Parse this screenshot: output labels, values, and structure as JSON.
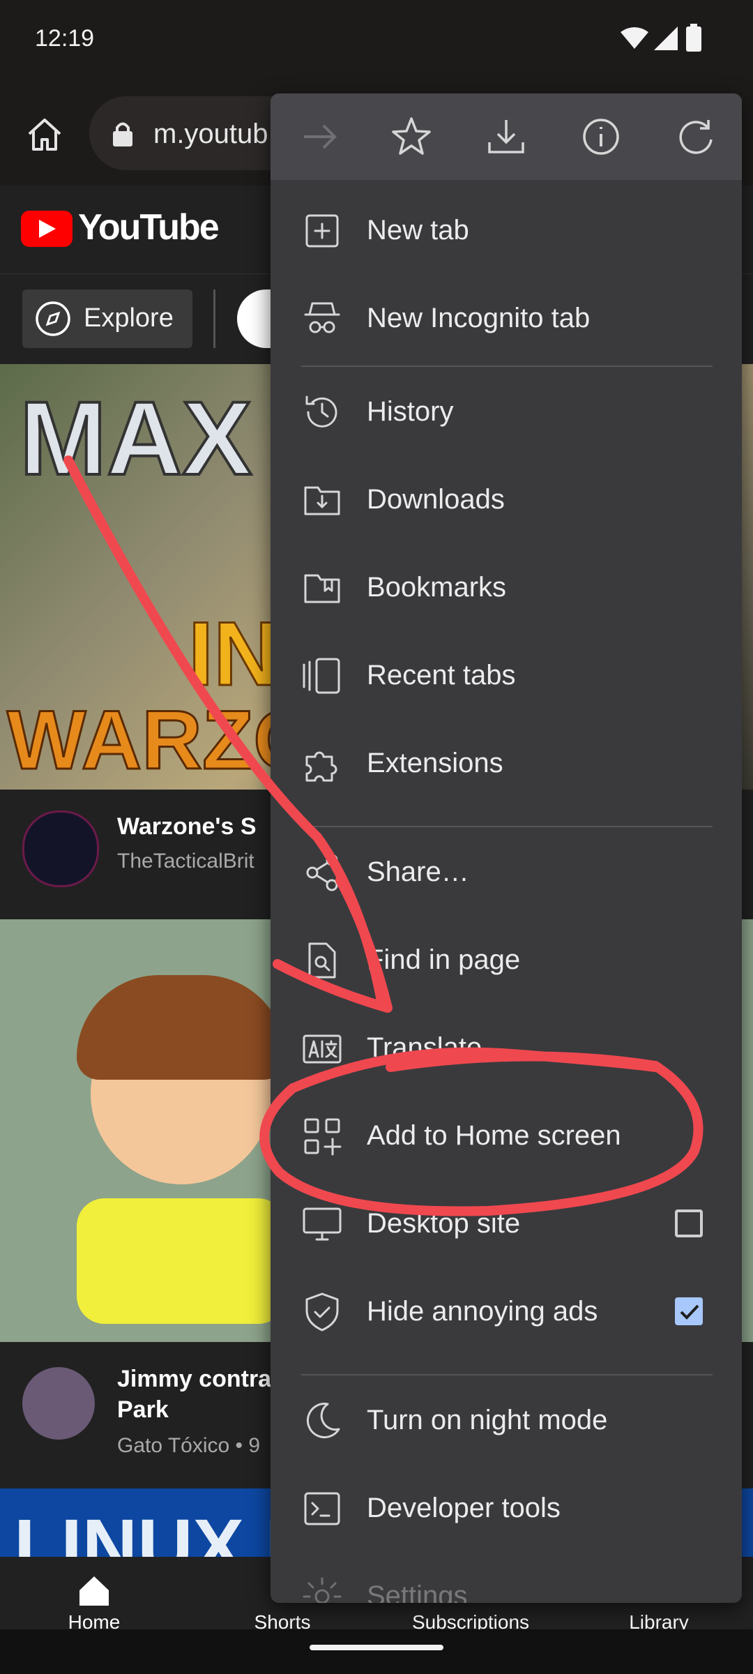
{
  "status_bar": {
    "time": "12:19"
  },
  "browser": {
    "url": "m.youtub"
  },
  "youtube": {
    "logo_text": "YouTube",
    "explore_label": "Explore",
    "videos": [
      {
        "title": "Warzone's S",
        "channel": "TheTacticalBrit",
        "thumb_text_1": "MAX",
        "thumb_text_2": "IN",
        "thumb_text_3": "WARZO"
      },
      {
        "title": "Jimmy contra",
        "title_line2": "Park",
        "channel": "Gato Tóxico • 9"
      },
      {
        "thumb_text": "LINUX L"
      }
    ]
  },
  "bottom_nav": {
    "items": [
      {
        "label": "Home"
      },
      {
        "label": "Shorts"
      },
      {
        "label": "Subscriptions"
      },
      {
        "label": "Library"
      }
    ]
  },
  "menu": {
    "items": [
      {
        "label": "New tab",
        "icon": "plus-box-icon"
      },
      {
        "label": "New Incognito tab",
        "icon": "incognito-icon"
      },
      {
        "label": "History",
        "icon": "history-icon"
      },
      {
        "label": "Downloads",
        "icon": "downloads-folder-icon"
      },
      {
        "label": "Bookmarks",
        "icon": "bookmarks-folder-icon"
      },
      {
        "label": "Recent tabs",
        "icon": "recent-tabs-icon"
      },
      {
        "label": "Extensions",
        "icon": "puzzle-icon"
      },
      {
        "label": "Share…",
        "icon": "share-icon"
      },
      {
        "label": "Find in page",
        "icon": "find-in-page-icon"
      },
      {
        "label": "Translate…",
        "icon": "translate-icon"
      },
      {
        "label": "Add to Home screen",
        "icon": "add-to-home-icon"
      },
      {
        "label": "Desktop site",
        "icon": "desktop-icon",
        "checked": false
      },
      {
        "label": "Hide annoying ads",
        "icon": "shield-icon",
        "checked": true
      },
      {
        "label": "Turn on night mode",
        "icon": "moon-icon"
      },
      {
        "label": "Developer tools",
        "icon": "terminal-icon"
      },
      {
        "label": "Settings",
        "icon": "gear-icon"
      }
    ]
  },
  "colors": {
    "annotation": "#f0484f",
    "youtube_red": "#ff0000",
    "menu_bg": "#3a3a3d",
    "checkbox_on": "#a8c7fa"
  }
}
